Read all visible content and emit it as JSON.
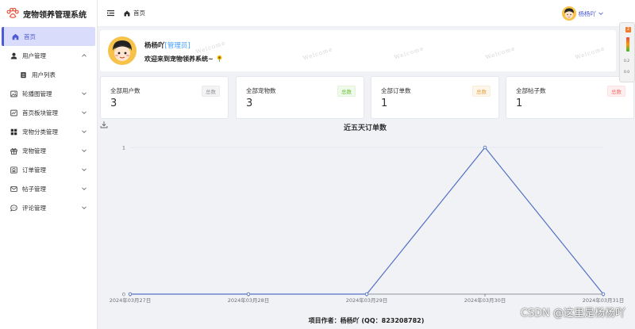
{
  "app": {
    "title": "宠物领养管理系统"
  },
  "colors": {
    "accent": "#4f5bd5",
    "link": "#409eff",
    "line": "#5470c6"
  },
  "sidebar": {
    "items": [
      {
        "label": "首页",
        "icon": "home-icon",
        "active": true
      },
      {
        "label": "用户管理",
        "icon": "user-icon",
        "chevron": "up"
      },
      {
        "label": "用户列表",
        "icon": "list-icon",
        "sub": true
      },
      {
        "label": "轮播图管理",
        "icon": "image-icon",
        "chevron": "down"
      },
      {
        "label": "首页板块管理",
        "icon": "board-icon",
        "chevron": "down"
      },
      {
        "label": "宠物分类管理",
        "icon": "grid-icon",
        "chevron": "down"
      },
      {
        "label": "宠物管理",
        "icon": "gift-icon",
        "chevron": "down"
      },
      {
        "label": "订单管理",
        "icon": "order-icon",
        "chevron": "down"
      },
      {
        "label": "帖子管理",
        "icon": "mail-icon",
        "chevron": "down"
      },
      {
        "label": "评论管理",
        "icon": "comment-icon",
        "chevron": "down"
      }
    ]
  },
  "header": {
    "breadcrumb": "首页",
    "username": "杨杨吖"
  },
  "welcome": {
    "name": "杨杨吖",
    "role": "[管理员]",
    "message": "欢迎来到宠物领养系统~",
    "watermark": "Welcome"
  },
  "stats": [
    {
      "label": "全部用户数",
      "value": "3",
      "tag": "总数",
      "tag_color": "#909399",
      "tag_bg": "#f4f4f5",
      "tag_border": "#e9e9eb"
    },
    {
      "label": "全部宠物数",
      "value": "3",
      "tag": "总数",
      "tag_color": "#67c23a",
      "tag_bg": "#f0f9eb",
      "tag_border": "#e1f3d8"
    },
    {
      "label": "全部订单数",
      "value": "1",
      "tag": "总数",
      "tag_color": "#e6a23c",
      "tag_bg": "#fdf6ec",
      "tag_border": "#faecd8"
    },
    {
      "label": "全部帖子数",
      "value": "1",
      "tag": "总数",
      "tag_color": "#f56c6c",
      "tag_bg": "#fef0f0",
      "tag_border": "#fde2e2"
    }
  ],
  "chart_data": {
    "type": "line",
    "title": "近五天订单数",
    "categories": [
      "2024年03月27日",
      "2024年03月28日",
      "2024年03月29日",
      "2024年03月30日",
      "2024年03月31日"
    ],
    "values": [
      0,
      0,
      0,
      1,
      0
    ],
    "yticks": [
      0,
      1
    ],
    "ylim": [
      0,
      1
    ],
    "grid": true,
    "xlabel": "",
    "ylabel": ""
  },
  "footer": {
    "text": "项目作者：杨杨吖 (QQ：823208782)"
  },
  "overlay": {
    "csdn": "CSDN @这里是杨杨吖"
  },
  "widget": {
    "badge": "2",
    "line1": "0.2",
    "line2": "0.0"
  }
}
